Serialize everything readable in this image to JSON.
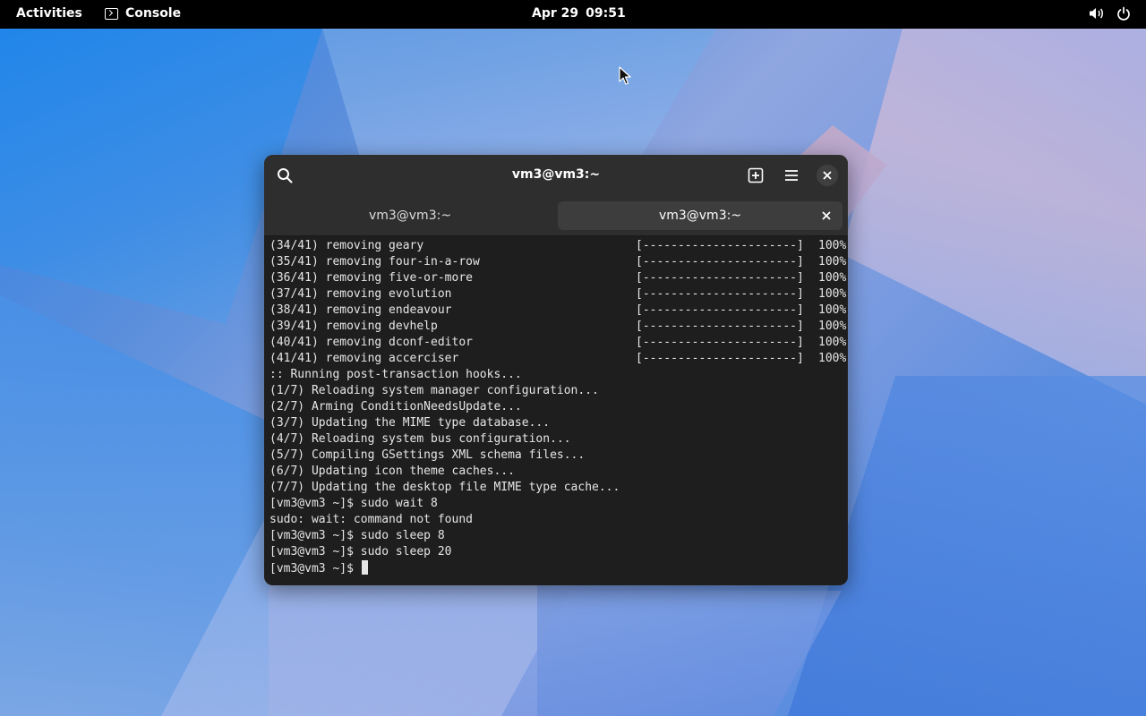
{
  "topbar": {
    "activities": "Activities",
    "app_name": "Console",
    "date": "Apr 29",
    "time": "09:51"
  },
  "window": {
    "title": "vm3@vm3:~",
    "tabs": [
      {
        "label": "vm3@vm3:~",
        "active": false
      },
      {
        "label": "vm3@vm3:~",
        "active": true
      }
    ]
  },
  "terminal": {
    "progress_lines": [
      {
        "text": "(34/41) removing geary",
        "bar": "[----------------------]",
        "pct": "100%"
      },
      {
        "text": "(35/41) removing four-in-a-row",
        "bar": "[----------------------]",
        "pct": "100%"
      },
      {
        "text": "(36/41) removing five-or-more",
        "bar": "[----------------------]",
        "pct": "100%"
      },
      {
        "text": "(37/41) removing evolution",
        "bar": "[----------------------]",
        "pct": "100%"
      },
      {
        "text": "(38/41) removing endeavour",
        "bar": "[----------------------]",
        "pct": "100%"
      },
      {
        "text": "(39/41) removing devhelp",
        "bar": "[----------------------]",
        "pct": "100%"
      },
      {
        "text": "(40/41) removing dconf-editor",
        "bar": "[----------------------]",
        "pct": "100%"
      },
      {
        "text": "(41/41) removing accerciser",
        "bar": "[----------------------]",
        "pct": "100%"
      }
    ],
    "output_lines": [
      ":: Running post-transaction hooks...",
      "(1/7) Reloading system manager configuration...",
      "(2/7) Arming ConditionNeedsUpdate...",
      "(3/7) Updating the MIME type database...",
      "(4/7) Reloading system bus configuration...",
      "(5/7) Compiling GSettings XML schema files...",
      "(6/7) Updating icon theme caches...",
      "(7/7) Updating the desktop file MIME type cache...",
      "[vm3@vm3 ~]$ sudo wait 8",
      "sudo: wait: command not found",
      "[vm3@vm3 ~]$ sudo sleep 8",
      "[vm3@vm3 ~]$ sudo sleep 20"
    ],
    "prompt": "[vm3@vm3 ~]$ "
  },
  "icons": {
    "console": "console-icon",
    "volume": "volume-icon",
    "power": "power-icon",
    "search": "search-icon",
    "new_tab": "new-tab-icon",
    "menu": "hamburger-menu-icon",
    "close": "close-icon"
  }
}
